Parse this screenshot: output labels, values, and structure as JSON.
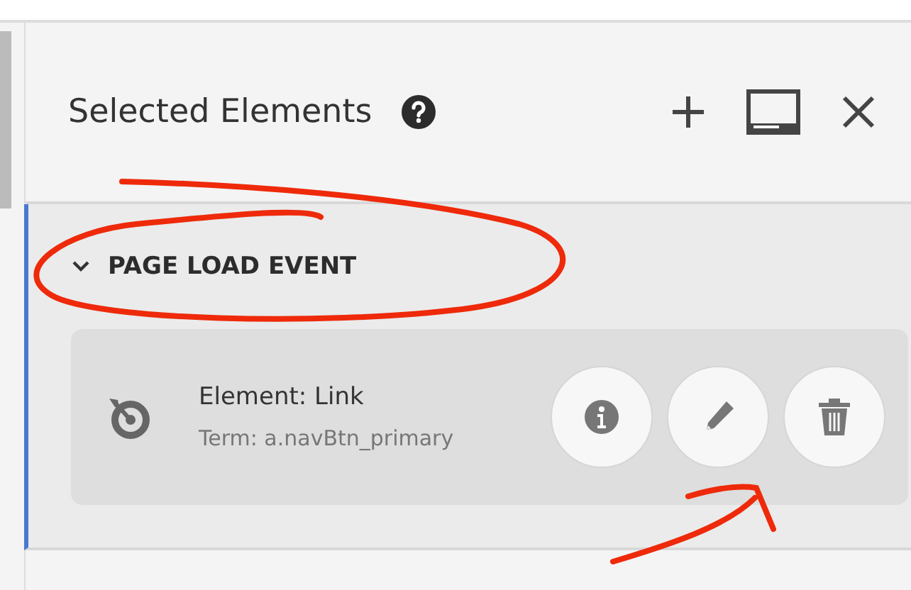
{
  "panel": {
    "title": "Selected Elements"
  },
  "section": {
    "title": "PAGE LOAD EVENT",
    "expanded": true,
    "items": [
      {
        "title": "Element: Link",
        "term": "Term: a.navBtn_primary"
      }
    ]
  }
}
